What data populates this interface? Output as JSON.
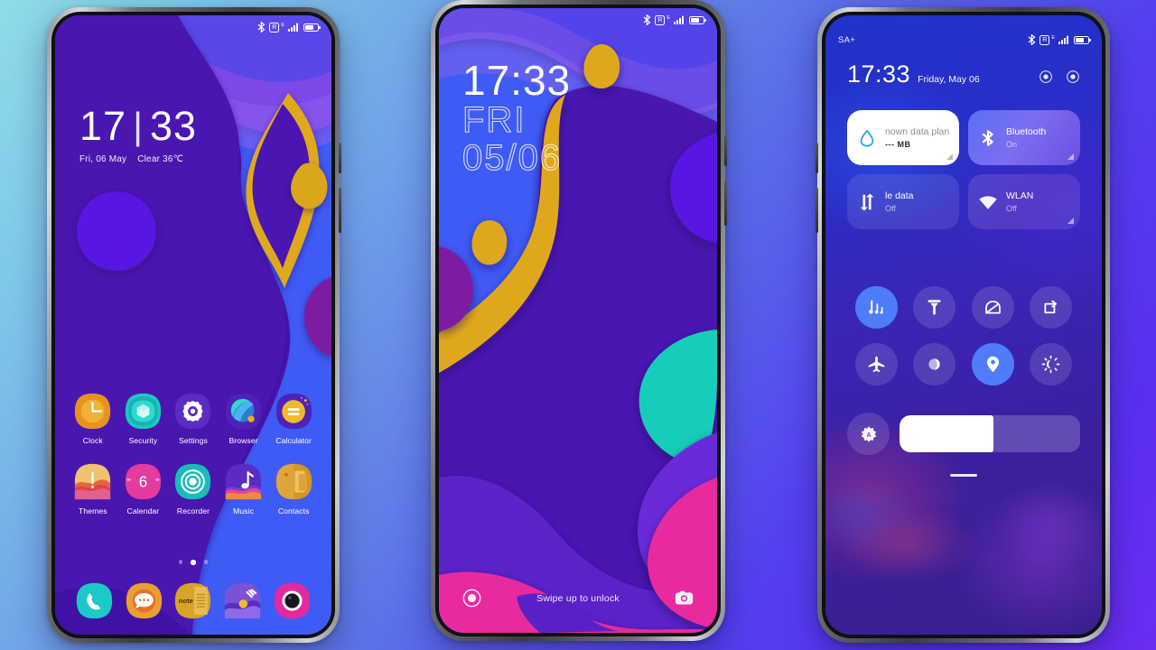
{
  "scene": {
    "background_from": "#8fdce8",
    "background_to": "#6a2df2"
  },
  "phone1": {
    "name": "home-screen",
    "statusbar": {
      "carrier": "",
      "icons": [
        "bluetooth-icon",
        "roaming-icon",
        "signal-icon",
        "battery-icon"
      ],
      "roaming_label": "R",
      "network_label": "E"
    },
    "clock": {
      "hours": "17",
      "separator": "|",
      "minutes": "33",
      "date": "Fri, 06 May",
      "weather": "Clear 36℃"
    },
    "apps_row1": [
      {
        "label": "Clock",
        "icon": "clock-icon"
      },
      {
        "label": "Security",
        "icon": "security-icon"
      },
      {
        "label": "Settings",
        "icon": "settings-icon"
      },
      {
        "label": "Browser",
        "icon": "browser-icon"
      },
      {
        "label": "Calculator",
        "icon": "calculator-icon"
      }
    ],
    "apps_row2": [
      {
        "label": "Themes",
        "icon": "themes-icon"
      },
      {
        "label": "Calendar",
        "icon": "calendar-icon",
        "day": "6"
      },
      {
        "label": "Recorder",
        "icon": "recorder-icon"
      },
      {
        "label": "Music",
        "icon": "music-icon"
      },
      {
        "label": "Contacts",
        "icon": "contacts-icon"
      }
    ],
    "page_dots": {
      "count": 3,
      "active_index": 1
    },
    "dock": [
      {
        "label": "Phone",
        "icon": "phone-icon"
      },
      {
        "label": "Messages",
        "icon": "messages-icon"
      },
      {
        "label": "Notes",
        "icon": "notes-icon"
      },
      {
        "label": "Gallery",
        "icon": "gallery-icon"
      },
      {
        "label": "Camera",
        "icon": "camera-icon"
      }
    ]
  },
  "phone2": {
    "name": "lock-screen",
    "statusbar": {
      "carrier": "",
      "roaming_label": "R",
      "network_label": "E"
    },
    "clock": {
      "time": "17:33",
      "day_of_week": "FRI",
      "date": "05/06"
    },
    "bottom": {
      "left_icon": "recorder-shortcut-icon",
      "hint": "Swipe up to unlock",
      "right_icon": "camera-shortcut-icon"
    }
  },
  "phone3": {
    "name": "control-center",
    "statusbar": {
      "carrier": "SA+",
      "roaming_label": "R",
      "network_label": "E"
    },
    "header": {
      "time": "17:33",
      "date": "Friday, May 06",
      "icons": [
        "settings-shortcut-icon",
        "power-shortcut-icon"
      ]
    },
    "tiles": [
      {
        "title": "nown data plan",
        "status": "--- MB",
        "icon": "data-drop-icon",
        "state": "white",
        "clipped": true
      },
      {
        "title": "Bluetooth",
        "status": "On",
        "icon": "bluetooth-icon",
        "state": "on"
      },
      {
        "title": "le data",
        "status": "Off",
        "icon": "mobile-data-icon",
        "state": "off",
        "clipped": true
      },
      {
        "title": "WLAN",
        "status": "Off",
        "icon": "wifi-icon",
        "state": "off"
      }
    ],
    "toggles": [
      {
        "name": "sound-toggle",
        "icon": "sound-icon",
        "active": true
      },
      {
        "name": "flashlight-toggle",
        "icon": "flashlight-icon",
        "active": false
      },
      {
        "name": "screenshot-toggle",
        "icon": "screenshot-icon",
        "active": false
      },
      {
        "name": "auto-rotate-toggle",
        "icon": "rotate-icon",
        "active": false
      },
      {
        "name": "airplane-toggle",
        "icon": "airplane-icon",
        "active": false
      },
      {
        "name": "reading-mode-toggle",
        "icon": "reading-mode-icon",
        "active": false
      },
      {
        "name": "location-toggle",
        "icon": "location-icon",
        "active": true
      },
      {
        "name": "dark-mode-toggle",
        "icon": "brightness-night-icon",
        "active": false
      }
    ],
    "brightness": {
      "auto_label": "A",
      "value_percent": 52
    }
  }
}
